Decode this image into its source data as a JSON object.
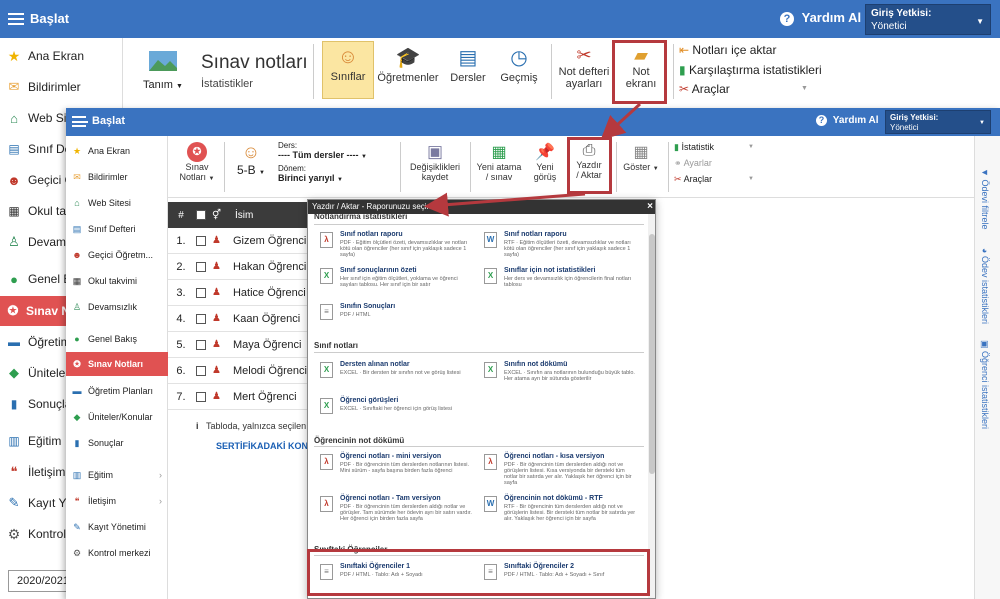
{
  "back": {
    "app_title": "Başlat",
    "help_label": "Yardım Al",
    "auth_label": "Giriş Yetkisi:",
    "auth_value": "Yönetici",
    "page_title": "Sınav notları",
    "page_subtitle": "İstatistikler",
    "tanim_label": "Tanım",
    "ribbon": {
      "siniflar": "Sınıflar",
      "ogretmenler": "Öğretmenler",
      "dersler": "Dersler",
      "gecmis": "Geçmiş",
      "not_defteri_1": "Not defteri",
      "not_defteri_2": "ayarları",
      "not_ekrani_1": "Not",
      "not_ekrani_2": "ekranı",
      "notlari_ice_aktar": "Notları içe aktar",
      "karsilastirma": "Karşılaştırma istatistikleri",
      "araclar": "Araçlar"
    },
    "sidebar": [
      "Ana Ekran",
      "Bildirimler",
      "Web Sit",
      "Sınıf De",
      "Geçici Ö",
      "Okul tak",
      "Devams",
      "Genel B",
      "Sınav N",
      "Öğretim",
      "Üniteler",
      "Sonuçla",
      "Eğitim",
      "İletişim",
      "Kayıt Yö",
      "Kontrol"
    ],
    "year": "2020/2021"
  },
  "front": {
    "app_title": "Başlat",
    "help_label": "Yardım Al",
    "auth_label": "Giriş Yetkisi:",
    "auth_value": "Yönetici",
    "sidebar": [
      "Ana Ekran",
      "Bildirimler",
      "Web Sitesi",
      "Sınıf Defteri",
      "Geçici Öğretm...",
      "Okul takvimi",
      "Devamsızlık",
      "Genel Bakış",
      "Sınav Notları",
      "Öğretim Planları",
      "Üniteler/Konular",
      "Sonuçlar",
      "Eğitim",
      "İletişim",
      "Kayıt Yönetimi",
      "Kontrol merkezi"
    ],
    "toolbar": {
      "sinav_notlari_1": "Sınav",
      "sinav_notlari_2": "Notları",
      "class_value": "5-B",
      "ders_label": "Ders:",
      "ders_value": "---- Tüm dersler ----",
      "donem_label": "Dönem:",
      "donem_value": "Birinci yarıyıl",
      "kaydet_1": "Değişiklikleri",
      "kaydet_2": "kaydet",
      "yeni_atama_1": "Yeni atama",
      "yeni_atama_2": "/ sınav",
      "yeni_gorus_1": "Yeni",
      "yeni_gorus_2": "görüş",
      "yazdir_1": "Yazdır",
      "yazdir_2": "/ Aktar",
      "goster": "Göster",
      "istatistik": "İstatistik",
      "ayarlar": "Ayarlar",
      "araclar": "Araçlar"
    },
    "table": {
      "col_hash": "#",
      "col_isim": "İsim",
      "rows": [
        {
          "no": "1.",
          "name": "Gizem Öğrenci"
        },
        {
          "no": "2.",
          "name": "Hakan Öğrenci"
        },
        {
          "no": "3.",
          "name": "Hatice Öğrenci"
        },
        {
          "no": "4.",
          "name": "Kaan Öğrenci"
        },
        {
          "no": "5.",
          "name": "Maya Öğrenci"
        },
        {
          "no": "6.",
          "name": "Melodi Öğrenci"
        },
        {
          "no": "7.",
          "name": "Mert Öğrenci"
        }
      ]
    },
    "info_text": "Tabloda, yalnızca seçilen",
    "cert_link": "SERTİFİKADAKİ KONU",
    "right_tabs": [
      "Ödevi filtrele",
      "Ödev istatistikleri",
      "Öğrenci istatistikleri"
    ]
  },
  "modal": {
    "title": "Yazdır / Aktar - Raporunuzu seçin:",
    "close": "×",
    "sections": {
      "s1": "Notlandırma istatistikleri",
      "s2": "Sınıf notları",
      "s3": "Öğrencinin not dökümü",
      "s4": "Sınıftaki Öğrenciler"
    },
    "reports": [
      {
        "title": "Sınıf notları raporu",
        "desc": "PDF · Eğitim ölçütleri özeti, devamsızlıklar ve notları kötü olan öğrenciler (her sınıf için yaklaşık sadece 1 sayfa)",
        "icon": "pdf"
      },
      {
        "title": "Sınıf notları raporu",
        "desc": "RTF · Eğitim ölçütleri özeti, devamsızlıklar ve notları kötü olan öğrenciler (her sınıf için yaklaşık sadece 1 sayfa)",
        "icon": "word"
      },
      {
        "title": "Sınıf sonuçlarının özeti",
        "desc": "Her sınıf için eğitim ölçütleri, yoklama ve öğrenci sayıları tablosu. Her sınıf için bir satır",
        "icon": "excel"
      },
      {
        "title": "Sınıflar için not istatistikleri",
        "desc": "Her ders ve devamsızlık için öğrencilerin final notları tablosu",
        "icon": "excel"
      },
      {
        "title": "Sınıfın Sonuçları",
        "desc": "PDF / HTML",
        "icon": "doc"
      },
      {
        "title": "Dersten alınan notlar",
        "desc": "EXCEL · Bir dersten bir sınıfın not ve görüş listesi",
        "icon": "excel"
      },
      {
        "title": "Sınıfın not dökümü",
        "desc": "EXCEL · Sınıfın ara notlarının bulunduğu büyük tablo. Her atama ayrı bir sütunda gösterilir",
        "icon": "excel"
      },
      {
        "title": "Öğrenci görüşleri",
        "desc": "EXCEL · Sınıftaki her öğrenci için görüş listesi",
        "icon": "excel"
      },
      {
        "title": "Öğrenci notları - mini versiyon",
        "desc": "PDF · Bir öğrencinin tüm derslerden notlarının listesi. Mini sürüm - sayfa başına birden fazla öğrenci",
        "icon": "pdf"
      },
      {
        "title": "Öğrenci notları - kısa versiyon",
        "desc": "PDF · Bir öğrencinin tüm derslerden aldığı not ve görüşlerin listesi. Kısa versiyonda bir dersteki tüm notlar bir satırda yer alır. Yaklaşık her öğrenci için bir sayfa",
        "icon": "pdf"
      },
      {
        "title": "Öğrenci notları - Tam versiyon",
        "desc": "PDF · Bir öğrencinin tüm derslerden aldığı notlar ve görüşler. Tam sürümde her ödevin ayrı bir satırı vardır. Her öğrenci için birden fazla sayfa",
        "icon": "pdf"
      },
      {
        "title": "Öğrencinin not dökümü - RTF",
        "desc": "RTF · Bir öğrencinin tüm derslerden aldığı not ve görüşlerin listesi. Bir dersteki tüm notlar bir satırda yer alır. Yaklaşık her öğrenci için bir sayfa",
        "icon": "word"
      },
      {
        "title": "Sınıftaki Öğrenciler 1",
        "desc": "PDF / HTML · Tablo: Adı + Soyadı",
        "icon": "doc"
      },
      {
        "title": "Sınıftaki Öğrenciler 2",
        "desc": "PDF / HTML · Tablo: Adı + Soyadı + Sınıf",
        "icon": "doc"
      }
    ]
  },
  "colors": {
    "top_bar": "#3a73c0",
    "active_item": "#e05252",
    "highlight": "#b5393e",
    "link": "#1a5fb4"
  }
}
